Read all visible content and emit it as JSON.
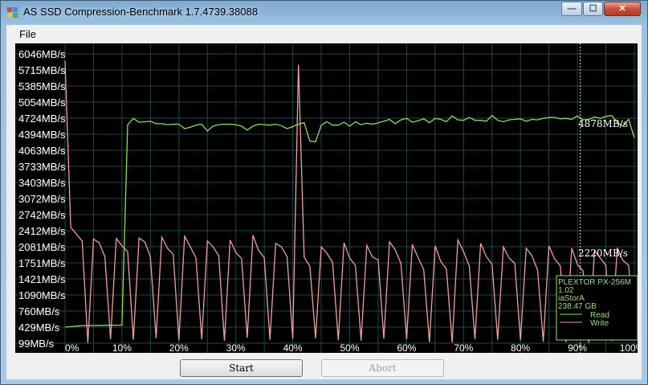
{
  "window": {
    "title": "AS SSD Compression-Benchmark 1.7.4739.38088"
  },
  "title_controls": {
    "minimize": "—",
    "maximize": "☐",
    "close": "✕"
  },
  "menu": {
    "file": "File"
  },
  "chart_data": {
    "type": "line",
    "title": "",
    "xlabel": "",
    "ylabel": "",
    "y_tick_labels": [
      "6046MB/s",
      "5715MB/s",
      "5385MB/s",
      "5054MB/s",
      "4724MB/s",
      "4394MB/s",
      "4063MB/s",
      "3733MB/s",
      "3403MB/s",
      "3072MB/s",
      "2742MB/s",
      "2412MB/s",
      "2081MB/s",
      "1751MB/s",
      "1421MB/s",
      "1090MB/s",
      "760MB/s",
      "429MB/s",
      "99MB/s"
    ],
    "x_tick_labels": [
      "0%",
      "10%",
      "20%",
      "30%",
      "40%",
      "50%",
      "60%",
      "70%",
      "80%",
      "90%",
      "100%"
    ],
    "ylim": [
      99,
      6046
    ],
    "xlim": [
      0,
      100
    ],
    "grid": true,
    "series": [
      {
        "name": "Read",
        "color": "#8fe05a",
        "x": [
          0,
          3,
          10,
          11,
          12,
          13,
          14,
          15,
          16,
          17,
          18,
          19,
          20,
          21,
          22,
          23,
          24,
          25,
          26,
          27,
          28,
          29,
          30,
          31,
          32,
          33,
          34,
          35,
          36,
          37,
          38,
          39,
          40,
          41,
          42,
          43,
          44,
          45,
          46,
          47,
          48,
          49,
          50,
          51,
          52,
          53,
          54,
          55,
          56,
          57,
          58,
          59,
          60,
          61,
          62,
          63,
          64,
          65,
          66,
          67,
          68,
          69,
          70,
          71,
          72,
          73,
          74,
          75,
          76,
          77,
          78,
          79,
          80,
          81,
          82,
          83,
          84,
          85,
          86,
          87,
          88,
          89,
          90,
          91,
          92,
          93,
          94,
          95,
          96,
          97,
          98,
          99,
          100
        ],
        "values": [
          429,
          460,
          470,
          4590,
          4720,
          4640,
          4650,
          4660,
          4610,
          4610,
          4590,
          4600,
          4600,
          4510,
          4540,
          4580,
          4600,
          4460,
          4560,
          4590,
          4600,
          4600,
          4590,
          4560,
          4480,
          4560,
          4600,
          4590,
          4580,
          4600,
          4570,
          4510,
          4550,
          4600,
          4630,
          4250,
          4240,
          4580,
          4650,
          4580,
          4580,
          4640,
          4560,
          4650,
          4590,
          4620,
          4600,
          4630,
          4660,
          4700,
          4610,
          4690,
          4720,
          4640,
          4670,
          4710,
          4630,
          4720,
          4700,
          4650,
          4770,
          4690,
          4680,
          4740,
          4680,
          4680,
          4660,
          4780,
          4680,
          4650,
          4690,
          4700,
          4710,
          4660,
          4700,
          4690,
          4720,
          4740,
          4740,
          4710,
          4720,
          4700,
          4770,
          4690,
          4700,
          4750,
          4720,
          4760,
          4780,
          4640,
          4560,
          4700,
          4320
        ]
      },
      {
        "name": "Write",
        "color": "#f0a0a0",
        "x": [
          0,
          1,
          3,
          4,
          5,
          6,
          7,
          8,
          9,
          10,
          11,
          12,
          13,
          14,
          15,
          16,
          17,
          18,
          19,
          20,
          21,
          22,
          23,
          24,
          25,
          26,
          27,
          28,
          29,
          30,
          31,
          32,
          33,
          34,
          35,
          36,
          37,
          38,
          39,
          40,
          41,
          42,
          43,
          44,
          45,
          46,
          47,
          48,
          49,
          50,
          51,
          52,
          53,
          54,
          55,
          56,
          57,
          58,
          59,
          60,
          61,
          62,
          63,
          64,
          65,
          66,
          67,
          68,
          69,
          70,
          71,
          72,
          73,
          74,
          75,
          76,
          77,
          78,
          79,
          80,
          81,
          82,
          83,
          84,
          85,
          86,
          87,
          88,
          89,
          90,
          91,
          92,
          93,
          94,
          95,
          96,
          97,
          98,
          99,
          100
        ],
        "values": [
          5900,
          2480,
          2200,
          100,
          2240,
          2160,
          1880,
          180,
          2250,
          2100,
          1980,
          170,
          2260,
          2180,
          1870,
          200,
          2280,
          2050,
          1930,
          160,
          2300,
          2080,
          1850,
          180,
          2200,
          2080,
          1900,
          150,
          2220,
          1960,
          1840,
          210,
          2320,
          2000,
          1860,
          170,
          2150,
          2080,
          1880,
          190,
          5820,
          1870,
          1680,
          200,
          2080,
          1950,
          1760,
          160,
          2160,
          1850,
          1700,
          150,
          2110,
          1870,
          1810,
          190,
          2180,
          2020,
          1740,
          180,
          2130,
          1860,
          1610,
          120,
          2100,
          1780,
          1620,
          110,
          2220,
          1980,
          1690,
          180,
          2150,
          1880,
          1720,
          170,
          2080,
          1850,
          1740,
          160,
          2050,
          1900,
          1600,
          130,
          2100,
          1830,
          1690,
          120,
          2050,
          1720,
          1580,
          110,
          2000,
          1850,
          1700,
          140,
          2060,
          1800,
          1700,
          230
        ]
      }
    ],
    "annotations": [
      {
        "text": "4878MB/s"
      },
      {
        "text": "2220MB/s"
      }
    ],
    "info_box": {
      "device": "PLEXTOR PX-256M",
      "firmware": "1.02",
      "driver": "iaStorA",
      "capacity": "238.47 GB",
      "legend_read": "Read",
      "legend_write": "Write"
    }
  },
  "buttons": {
    "start": "Start",
    "abort": "Abort"
  }
}
